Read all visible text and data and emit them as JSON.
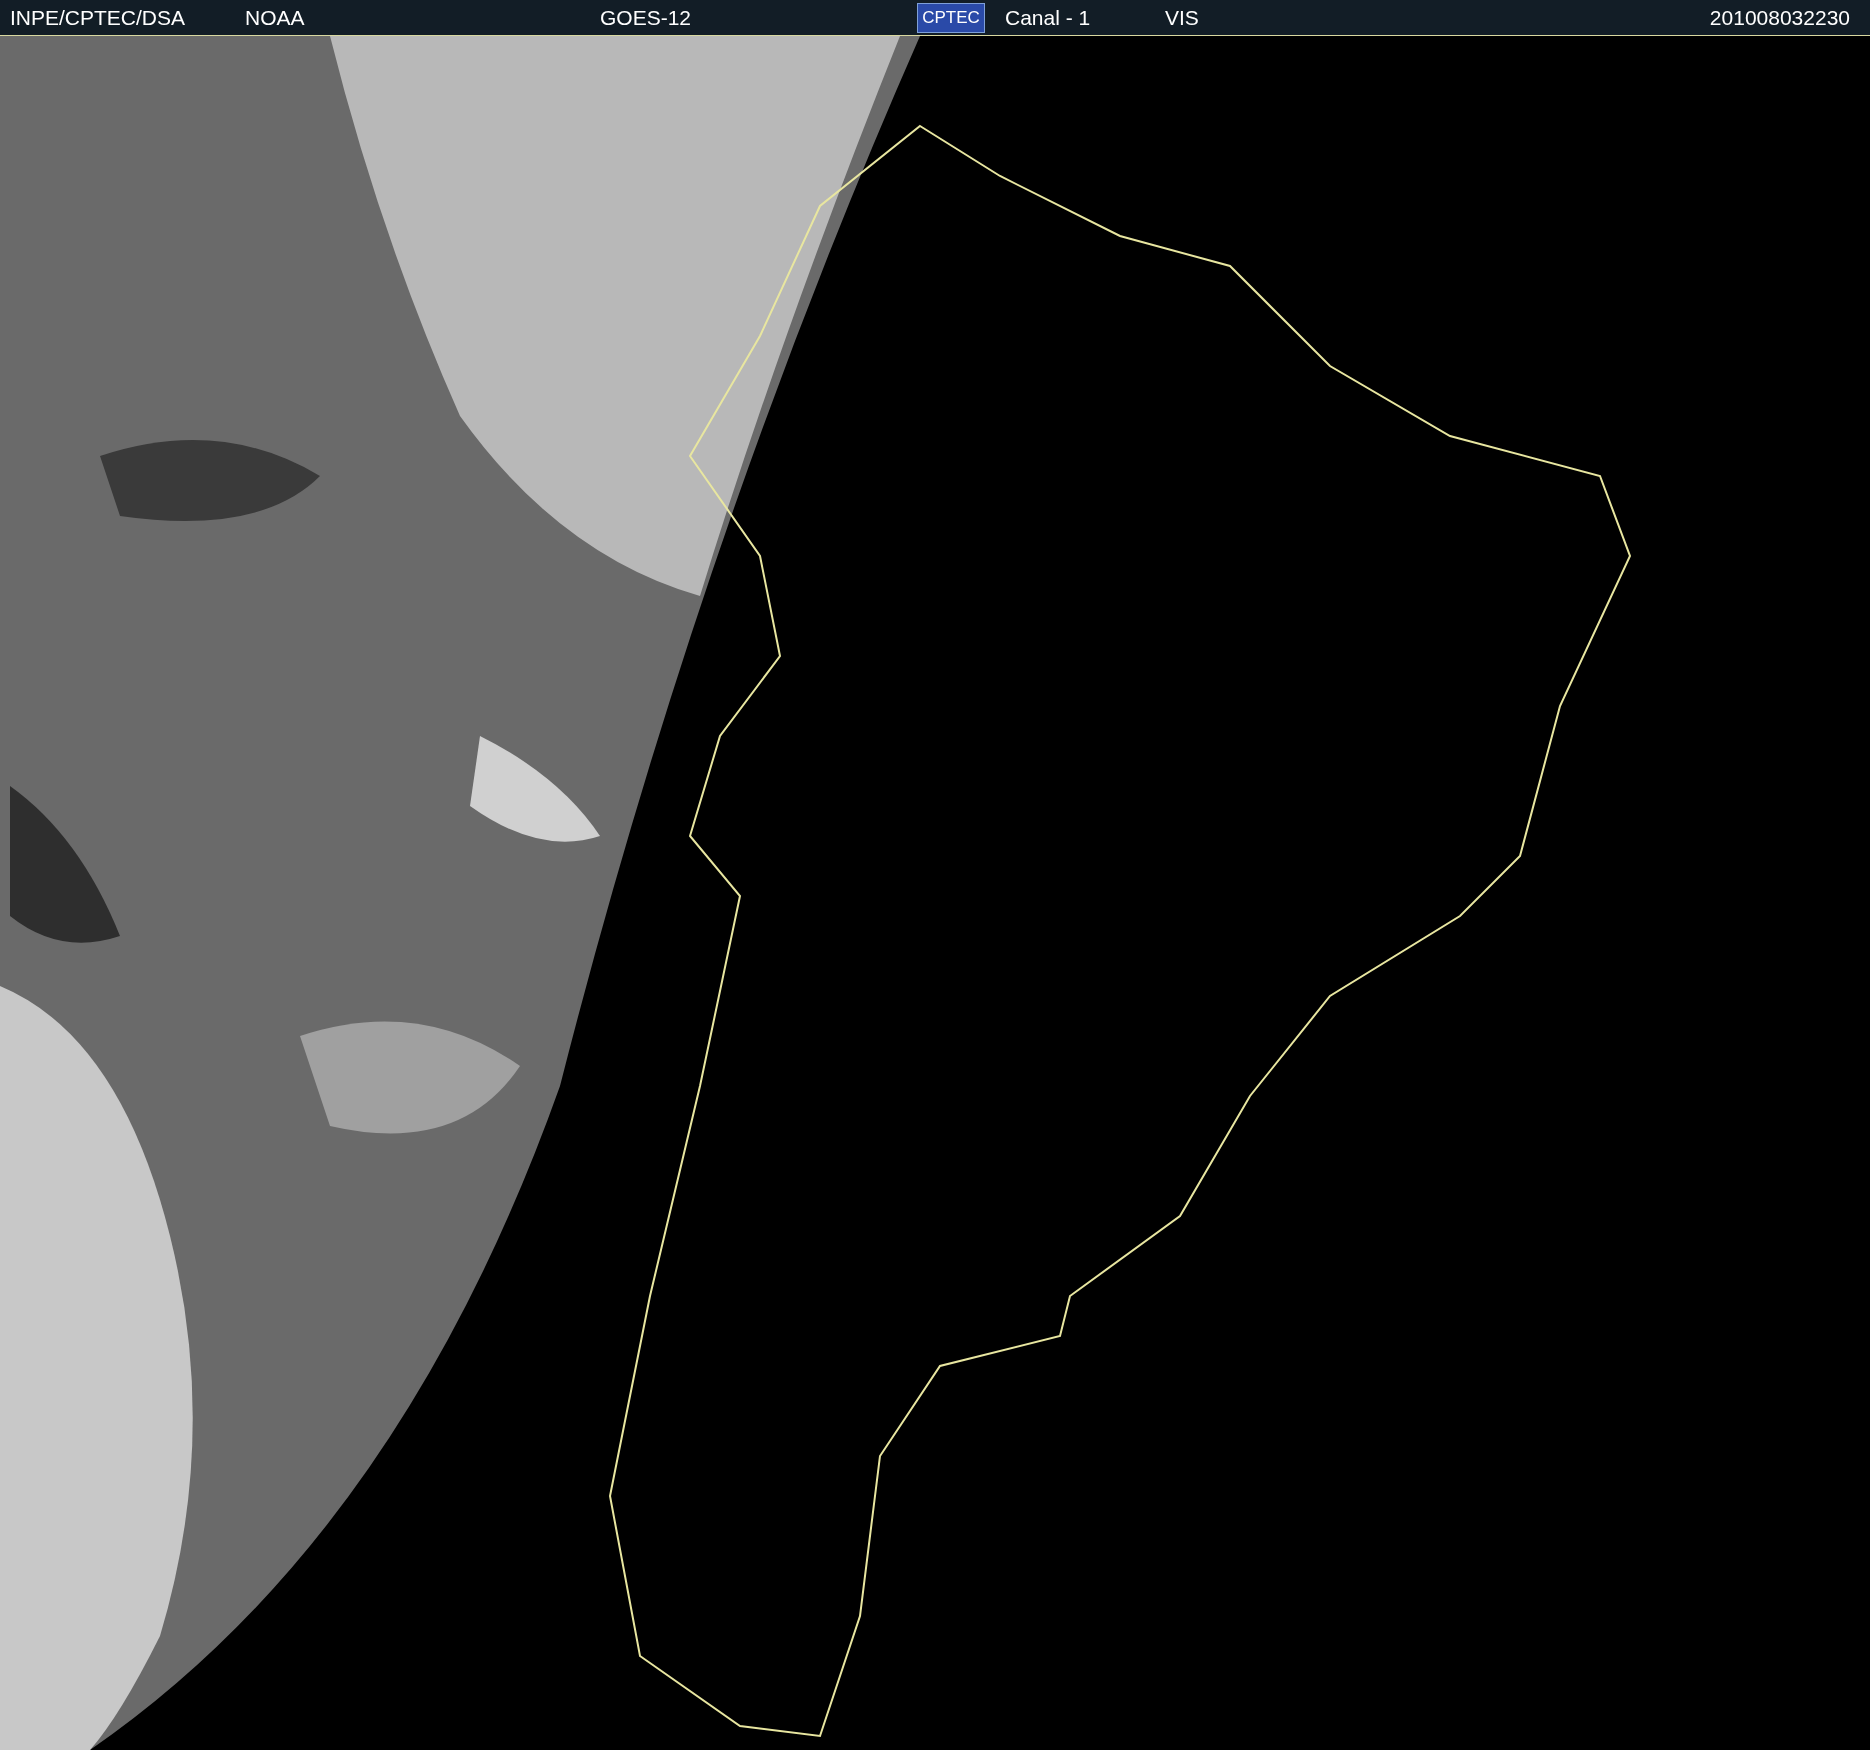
{
  "header": {
    "source": "INPE/CPTEC/DSA",
    "agency": "NOAA",
    "satellite": "GOES-12",
    "logo": "CPTEC",
    "channel": "Canal - 1",
    "band": "VIS",
    "timestamp": "201008032230"
  }
}
